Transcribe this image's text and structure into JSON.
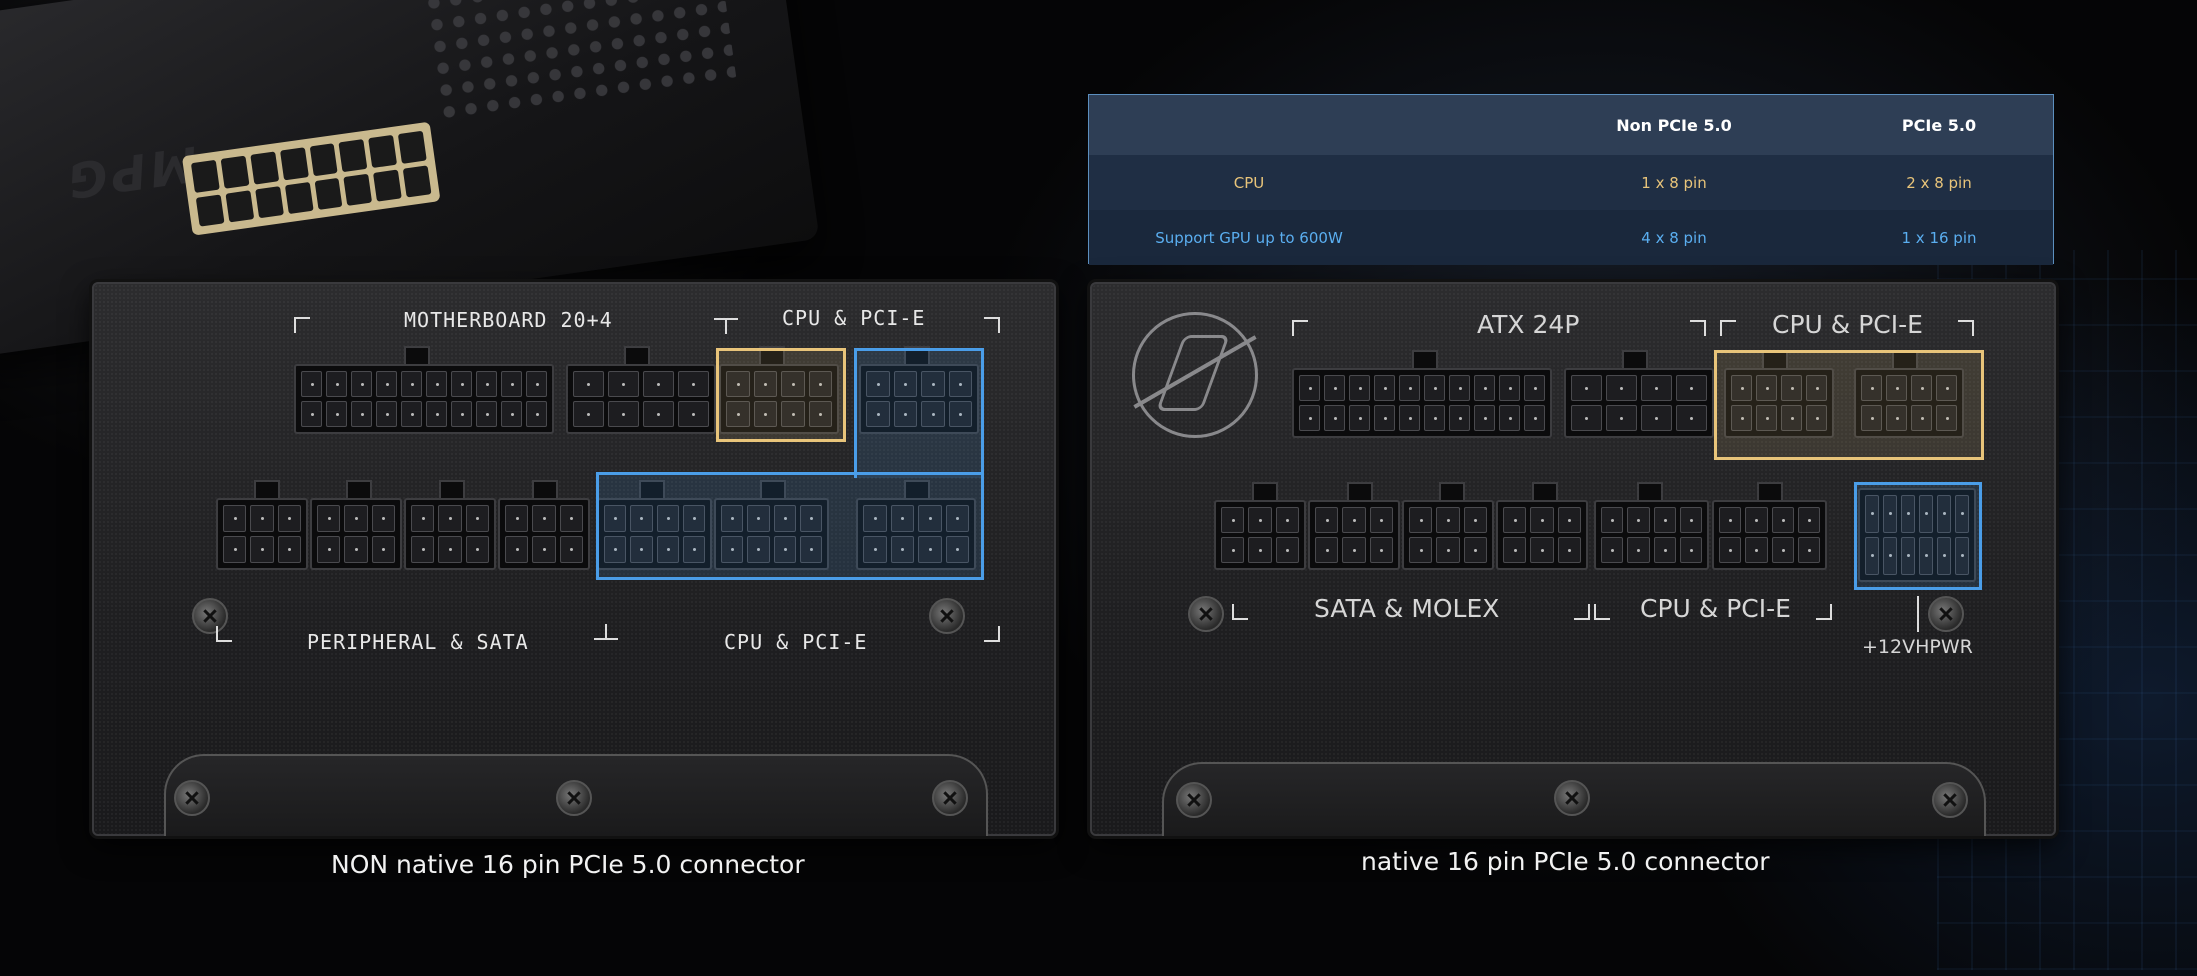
{
  "left_panel": {
    "label_motherboard": "MOTHERBOARD 20+4",
    "label_cpu_pcie_top": "CPU & PCI-E",
    "label_peripheral": "PERIPHERAL & SATA",
    "label_cpu_pcie_bottom": "CPU & PCI-E",
    "caption": "NON native 16 pin PCIe 5.0 connector"
  },
  "right_panel": {
    "label_atx": "ATX 24P",
    "label_cpu_pcie_top": "CPU & PCI-E",
    "label_sata_molex": "SATA & MOLEX",
    "label_cpu_pcie_bottom": "CPU & PCI-E",
    "label_12vhpwr": "+12VHPWR",
    "caption": "native 16 pin PCIe 5.0 connector"
  },
  "spec_table": {
    "headers": [
      "",
      "Non PCIe 5.0",
      "PCIe 5.0"
    ],
    "rows": [
      [
        "CPU",
        "1 x 8 pin",
        "2 x 8 pin"
      ],
      [
        "Support GPU up to 600W",
        "4 x 8 pin",
        "1 x 16 pin"
      ]
    ]
  },
  "colors": {
    "cpu_highlight": "#e8c47a",
    "gpu_highlight": "#4a9de8"
  },
  "top_unit_logo": "MPG"
}
